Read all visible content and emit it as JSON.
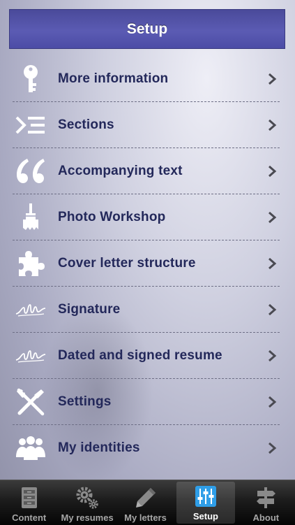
{
  "header": {
    "title": "Setup"
  },
  "menu": {
    "items": [
      {
        "label": "More information",
        "icon": "key-icon"
      },
      {
        "label": "Sections",
        "icon": "sections-list-icon"
      },
      {
        "label": "Accompanying text",
        "icon": "quote-icon"
      },
      {
        "label": "Photo Workshop",
        "icon": "paintbrush-icon"
      },
      {
        "label": "Cover letter structure",
        "icon": "puzzle-piece-icon"
      },
      {
        "label": "Signature",
        "icon": "signature-icon"
      },
      {
        "label": "Dated and signed resume",
        "icon": "signature-icon"
      },
      {
        "label": "Settings",
        "icon": "tools-icon"
      },
      {
        "label": "My identities",
        "icon": "people-group-icon"
      }
    ]
  },
  "tabbar": {
    "active": "Setup",
    "tabs": [
      {
        "label": "Content",
        "icon": "cabinet-icon"
      },
      {
        "label": "My resumes",
        "icon": "gears-icon"
      },
      {
        "label": "My letters",
        "icon": "pencil-icon"
      },
      {
        "label": "Setup",
        "icon": "sliders-icon"
      },
      {
        "label": "About",
        "icon": "signpost-icon"
      }
    ]
  },
  "colors": {
    "header_bg": "#5353a8",
    "label_text": "#23285a",
    "tab_active_label": "#ffffff",
    "tab_inactive_label": "#a6a6a6"
  }
}
